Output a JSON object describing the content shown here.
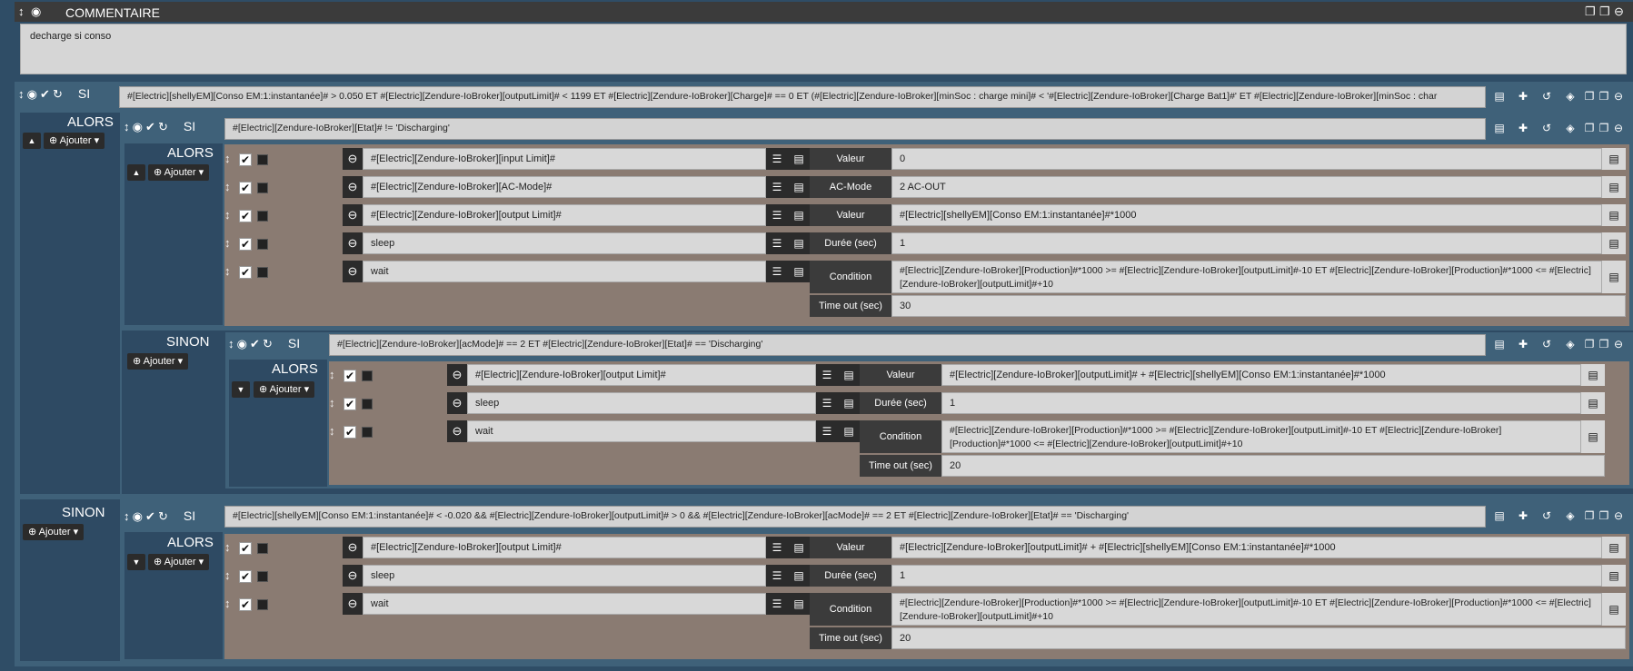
{
  "comment_block": {
    "title": "COMMENTAIRE",
    "text": "decharge si conso"
  },
  "labels": {
    "si": "SI",
    "alors": "ALORS",
    "sinon": "SINON",
    "ajouter": "Ajouter"
  },
  "si1": {
    "condition": "#[Electric][shellyEM][Conso EM:1:instantanée]#  > 0.050 ET #[Electric][Zendure-IoBroker][outputLimit]# < 1199 ET #[Electric][Zendure-IoBroker][Charge]# == 0 ET (#[Electric][Zendure-IoBroker][minSoc : charge mini]# < '#[Electric][Zendure-IoBroker][Charge Bat1]#'  ET #[Electric][Zendure-IoBroker][minSoc : char"
  },
  "si2": {
    "condition": "#[Electric][Zendure-IoBroker][Etat]# != 'Discharging'"
  },
  "alors2": [
    {
      "cmd": "#[Electric][Zendure-IoBroker][input Limit]#",
      "param": "Valeur",
      "value": "0"
    },
    {
      "cmd": "#[Electric][Zendure-IoBroker][AC-Mode]#",
      "param": "AC-Mode",
      "value": "2 AC-OUT"
    },
    {
      "cmd": "#[Electric][Zendure-IoBroker][output Limit]#",
      "param": "Valeur",
      "value": "#[Electric][shellyEM][Conso EM:1:instantanée]#*1000"
    },
    {
      "cmd": "sleep",
      "param": "Durée (sec)",
      "value": "1"
    },
    {
      "cmd": "wait",
      "param": "Condition",
      "value": "#[Electric][Zendure-IoBroker][Production]#*1000 >= #[Electric][Zendure-IoBroker][outputLimit]#-10 ET #[Electric][Zendure-IoBroker][Production]#*1000 <= #[Electric][Zendure-IoBroker][outputLimit]#+10",
      "param2": "Time out (sec)",
      "value2": "30"
    }
  ],
  "si3": {
    "condition": "#[Electric][Zendure-IoBroker][acMode]# == 2 ET #[Electric][Zendure-IoBroker][Etat]# == 'Discharging'"
  },
  "alors3": [
    {
      "cmd": "#[Electric][Zendure-IoBroker][output Limit]#",
      "param": "Valeur",
      "value": "#[Electric][Zendure-IoBroker][outputLimit]# + #[Electric][shellyEM][Conso EM:1:instantanée]#*1000"
    },
    {
      "cmd": "sleep",
      "param": "Durée (sec)",
      "value": "1"
    },
    {
      "cmd": "wait",
      "param": "Condition",
      "value": "#[Electric][Zendure-IoBroker][Production]#*1000 >= #[Electric][Zendure-IoBroker][outputLimit]#-10 ET #[Electric][Zendure-IoBroker][Production]#*1000 <= #[Electric][Zendure-IoBroker][outputLimit]#+10",
      "param2": "Time out (sec)",
      "value2": "20"
    }
  ],
  "si4": {
    "condition": "#[Electric][shellyEM][Conso EM:1:instantanée]#  < -0.020 && #[Electric][Zendure-IoBroker][outputLimit]# > 0 &&  #[Electric][Zendure-IoBroker][acMode]# == 2  ET #[Electric][Zendure-IoBroker][Etat]# == 'Discharging'"
  },
  "alors4": [
    {
      "cmd": "#[Electric][Zendure-IoBroker][output Limit]#",
      "param": "Valeur",
      "value": "#[Electric][Zendure-IoBroker][outputLimit]# + #[Electric][shellyEM][Conso EM:1:instantanée]#*1000"
    },
    {
      "cmd": "sleep",
      "param": "Durée (sec)",
      "value": "1"
    },
    {
      "cmd": "wait",
      "param": "Condition",
      "value": "#[Electric][Zendure-IoBroker][Production]#*1000 >= #[Electric][Zendure-IoBroker][outputLimit]#-10 ET #[Electric][Zendure-IoBroker][Production]#*1000 <= #[Electric][Zendure-IoBroker][outputLimit]#+10",
      "param2": "Time out (sec)",
      "value2": "20"
    }
  ]
}
